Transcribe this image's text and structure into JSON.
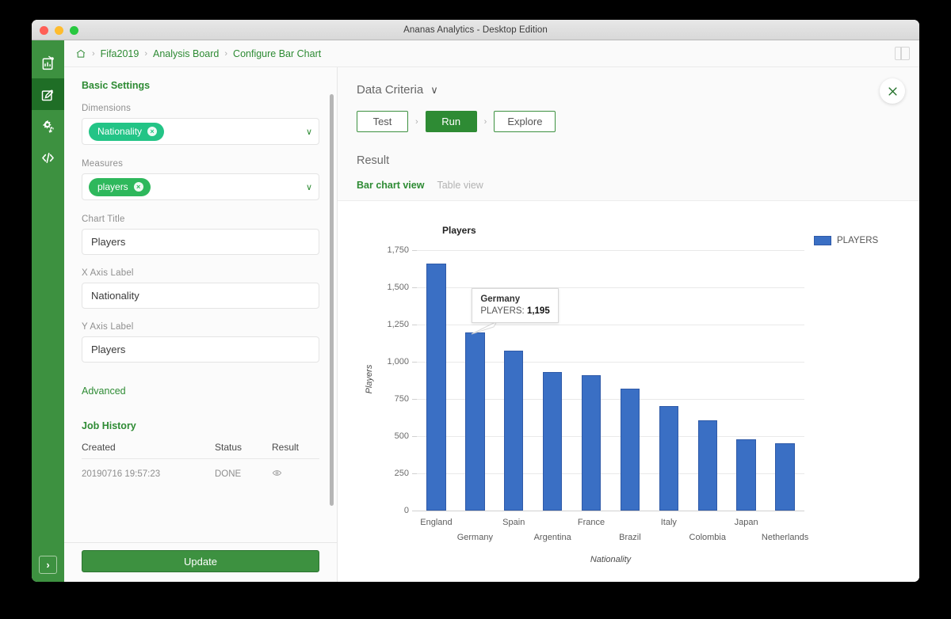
{
  "window": {
    "title": "Ananas Analytics - Desktop Edition"
  },
  "rail": {
    "items": [
      {
        "name": "rail-item-datasource",
        "icon": "chart-board-icon"
      },
      {
        "name": "rail-item-analysis-board",
        "icon": "edit-board-icon",
        "active": true
      },
      {
        "name": "rail-item-settings",
        "icon": "gears-icon"
      },
      {
        "name": "rail-item-code",
        "icon": "code-icon"
      }
    ],
    "expand_label": "›"
  },
  "breadcrumb": {
    "home_icon": "home-icon",
    "items": [
      "Fifa2019",
      "Analysis Board",
      "Configure Bar Chart"
    ],
    "separator": "›"
  },
  "left_panel": {
    "section_title": "Basic Settings",
    "dimensions": {
      "label": "Dimensions",
      "chip": "Nationality",
      "chip_color": "#23c486",
      "caret": "∨"
    },
    "measures": {
      "label": "Measures",
      "chip": "players",
      "chip_color": "#2eb85c",
      "caret": "∨"
    },
    "chart_title": {
      "label": "Chart Title",
      "value": "Players",
      "placeholder": "Chart Title"
    },
    "x_axis_label": {
      "label": "X Axis Label",
      "value": "Nationality",
      "placeholder": "X Axis Label"
    },
    "y_axis_label": {
      "label": "Y Axis Label",
      "value": "Players",
      "placeholder": "Y Axis Label"
    },
    "advanced_link": "Advanced",
    "job_history": {
      "title": "Job History",
      "columns": [
        "Created",
        "Status",
        "Result"
      ],
      "rows": [
        {
          "created": "20190716 19:57:23",
          "status": "DONE",
          "result_icon": "eye-icon"
        }
      ]
    },
    "update_button": "Update"
  },
  "right_panel": {
    "data_criteria": {
      "label": "Data Criteria",
      "caret": "∨"
    },
    "steps": [
      {
        "label": "Test",
        "primary": false
      },
      {
        "label": "Run",
        "primary": true
      },
      {
        "label": "Explore",
        "primary": false
      }
    ],
    "step_separator": "›",
    "result_title": "Result",
    "tabs": [
      {
        "label": "Bar chart view",
        "active": true
      },
      {
        "label": "Table view",
        "active": false
      }
    ],
    "close_icon": "close-icon",
    "panel_toggle_icon": "panel-layout-icon"
  },
  "tooltip": {
    "category": "Germany",
    "measure_label": "PLAYERS:",
    "value": "1,195"
  },
  "chart_data": {
    "type": "bar",
    "title": "Players",
    "xlabel": "Nationality",
    "ylabel": "Players",
    "categories": [
      "England",
      "Germany",
      "Spain",
      "Argentina",
      "France",
      "Brazil",
      "Italy",
      "Colombia",
      "Japan",
      "Netherlands"
    ],
    "values": [
      1660,
      1195,
      1075,
      930,
      910,
      820,
      700,
      605,
      480,
      450
    ],
    "series": [
      {
        "name": "PLAYERS",
        "color": "#3a6fc4",
        "values": [
          1660,
          1195,
          1075,
          930,
          910,
          820,
          700,
          605,
          480,
          450
        ]
      }
    ],
    "ylim": [
      0,
      1750
    ],
    "ytick_step": 250,
    "ytick_labels": [
      "0",
      "250",
      "500",
      "750",
      "1,000",
      "1,250",
      "1,500",
      "1,750"
    ],
    "grid": true,
    "legend": {
      "position": "right",
      "entries": [
        "PLAYERS"
      ]
    },
    "bar_color": "#3a6fc4"
  }
}
